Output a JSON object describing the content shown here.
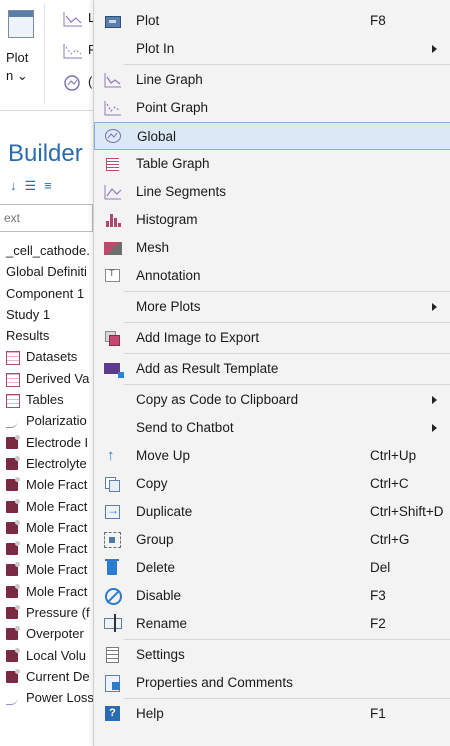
{
  "ribbon": {
    "plot_label": "Plot",
    "plot_sub": "n",
    "small_labels": [
      "L",
      "F",
      "("
    ]
  },
  "builder": {
    "title": "Builder",
    "search_placeholder": "ext"
  },
  "tree": [
    {
      "label": "_cell_cathode.",
      "icon": "none",
      "indent": false
    },
    {
      "label": "Global Definiti",
      "icon": "none",
      "indent": false
    },
    {
      "label": "Component 1",
      "icon": "none",
      "indent": false
    },
    {
      "label": "Study 1",
      "icon": "none",
      "indent": false
    },
    {
      "label": "Results",
      "icon": "none",
      "indent": false
    },
    {
      "label": "Datasets",
      "icon": "grid",
      "indent": true
    },
    {
      "label": "Derived Va",
      "icon": "grid",
      "indent": true
    },
    {
      "label": "Tables",
      "icon": "grid",
      "indent": true
    },
    {
      "label": "Polarizatio",
      "icon": "curve",
      "indent": true
    },
    {
      "label": "Electrode I",
      "icon": "book",
      "indent": true
    },
    {
      "label": "Electrolyte",
      "icon": "book",
      "indent": true
    },
    {
      "label": "Mole Fract",
      "icon": "book",
      "indent": true
    },
    {
      "label": "Mole Fract",
      "icon": "book",
      "indent": true
    },
    {
      "label": "Mole Fract",
      "icon": "book",
      "indent": true
    },
    {
      "label": "Mole Fract",
      "icon": "book",
      "indent": true
    },
    {
      "label": "Mole Fract",
      "icon": "book",
      "indent": true
    },
    {
      "label": "Mole Fract",
      "icon": "book",
      "indent": true
    },
    {
      "label": "Pressure (f",
      "icon": "book",
      "indent": true
    },
    {
      "label": "Overpoter",
      "icon": "book",
      "indent": true
    },
    {
      "label": "Local Volu",
      "icon": "book",
      "indent": true
    },
    {
      "label": "Current De",
      "icon": "book",
      "indent": true
    },
    {
      "label": "Power Losses",
      "icon": "curve",
      "indent": true
    }
  ],
  "menu": [
    {
      "label": "Plot",
      "shortcut": "F8",
      "icon": "plot-icon",
      "submenu": false
    },
    {
      "label": "Plot In",
      "shortcut": "",
      "icon": "",
      "submenu": true
    },
    {
      "sep": true
    },
    {
      "label": "Line Graph",
      "shortcut": "",
      "icon": "line-graph-icon",
      "submenu": false
    },
    {
      "label": "Point Graph",
      "shortcut": "",
      "icon": "point-graph-icon",
      "submenu": false
    },
    {
      "label": "Global",
      "shortcut": "",
      "icon": "global-icon",
      "submenu": false,
      "highlighted": true
    },
    {
      "label": "Table Graph",
      "shortcut": "",
      "icon": "table-graph-icon",
      "submenu": false
    },
    {
      "label": "Line Segments",
      "shortcut": "",
      "icon": "line-segments-icon",
      "submenu": false
    },
    {
      "label": "Histogram",
      "shortcut": "",
      "icon": "histogram-icon",
      "submenu": false
    },
    {
      "label": "Mesh",
      "shortcut": "",
      "icon": "mesh-icon",
      "submenu": false
    },
    {
      "label": "Annotation",
      "shortcut": "",
      "icon": "annotation-icon",
      "submenu": false
    },
    {
      "sep": true
    },
    {
      "label": "More Plots",
      "shortcut": "",
      "icon": "",
      "submenu": true
    },
    {
      "sep": true
    },
    {
      "label": "Add Image to Export",
      "shortcut": "",
      "icon": "add-image-icon",
      "submenu": false
    },
    {
      "sep": true
    },
    {
      "label": "Add as Result Template",
      "shortcut": "",
      "icon": "result-template-icon",
      "submenu": false
    },
    {
      "sep": true
    },
    {
      "label": "Copy as Code to Clipboard",
      "shortcut": "",
      "icon": "",
      "submenu": true
    },
    {
      "label": "Send to Chatbot",
      "shortcut": "",
      "icon": "",
      "submenu": true
    },
    {
      "label": "Move Up",
      "shortcut": "Ctrl+Up",
      "icon": "move-up-icon",
      "submenu": false
    },
    {
      "label": "Copy",
      "shortcut": "Ctrl+C",
      "icon": "copy-icon",
      "submenu": false
    },
    {
      "label": "Duplicate",
      "shortcut": "Ctrl+Shift+D",
      "icon": "duplicate-icon",
      "submenu": false
    },
    {
      "label": "Group",
      "shortcut": "Ctrl+G",
      "icon": "group-icon",
      "submenu": false
    },
    {
      "label": "Delete",
      "shortcut": "Del",
      "icon": "delete-icon",
      "submenu": false
    },
    {
      "label": "Disable",
      "shortcut": "F3",
      "icon": "disable-icon",
      "submenu": false
    },
    {
      "label": "Rename",
      "shortcut": "F2",
      "icon": "rename-icon",
      "submenu": false
    },
    {
      "sep": true
    },
    {
      "label": "Settings",
      "shortcut": "",
      "icon": "settings-icon",
      "submenu": false
    },
    {
      "label": "Properties and Comments",
      "shortcut": "",
      "icon": "properties-icon",
      "submenu": false
    },
    {
      "sep": true
    },
    {
      "label": "Help",
      "shortcut": "F1",
      "icon": "help-icon",
      "submenu": false
    }
  ],
  "colors": {
    "highlight_bg": "#dbe9f7",
    "highlight_border": "#7fb0e0",
    "menu_bg": "#f3f3f3",
    "accent": "#2b6cb0"
  }
}
